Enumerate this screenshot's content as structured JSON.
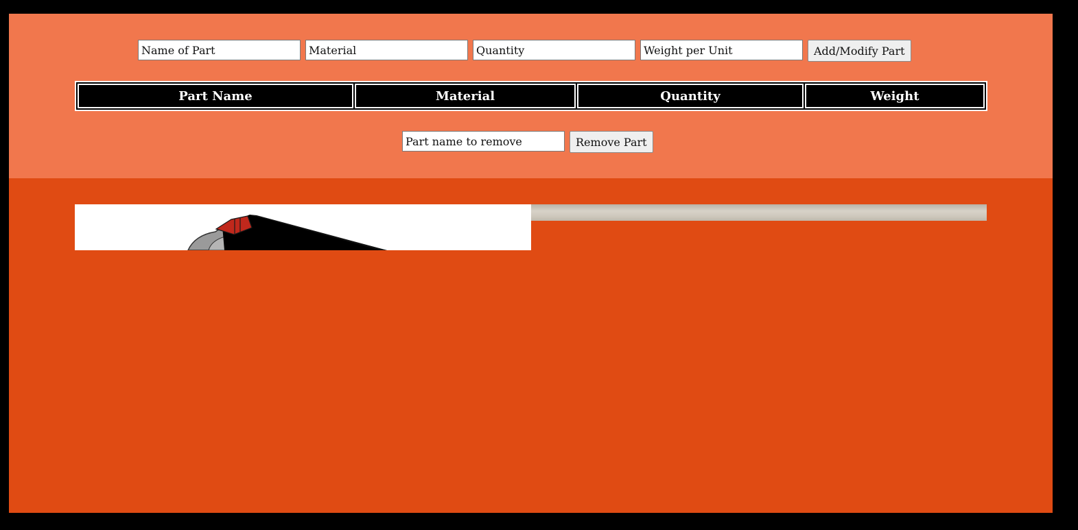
{
  "add_form": {
    "part_name_placeholder": "Name of Part",
    "material_placeholder": "Material",
    "quantity_placeholder": "Quantity",
    "weight_placeholder": "Weight per Unit",
    "submit_label": "Add/Modify Part"
  },
  "parts_table": {
    "headers": [
      "Part Name",
      "Material",
      "Quantity",
      "Weight"
    ],
    "rows": []
  },
  "remove_form": {
    "part_name_placeholder": "Part name to remove",
    "submit_label": "Remove Part"
  },
  "colors": {
    "page_background": "#000000",
    "top_panel": "#f1774d",
    "main_panel": "#e04b13",
    "table_header_background": "#000000",
    "table_header_text": "#ffffff"
  },
  "images": [
    {
      "name": "part-render-image",
      "description_icon": "cad-model-render"
    },
    {
      "name": "part-photo-image",
      "description_icon": "photo"
    }
  ]
}
